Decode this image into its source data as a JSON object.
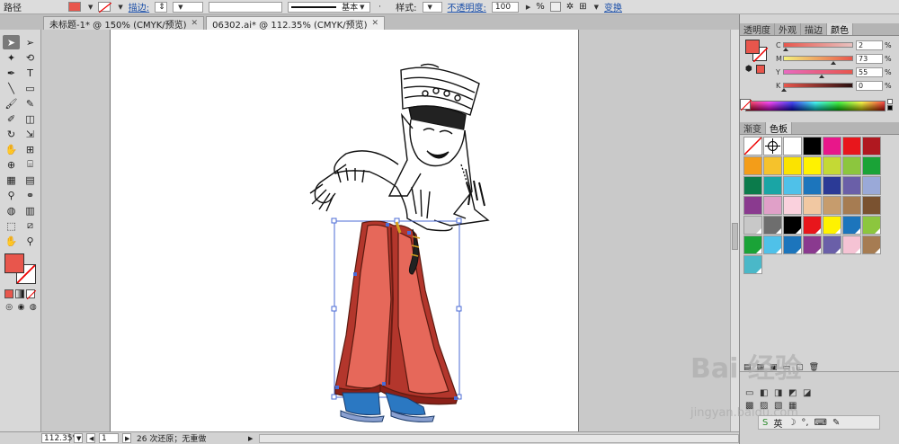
{
  "control_bar": {
    "path_label": "路径",
    "stroke_label": "描边:",
    "stroke_profile": "基本",
    "style_label": "样式:",
    "opacity_label": "不透明度:",
    "opacity_value": "100",
    "opacity_unit": "%",
    "transform_label": "变换",
    "fill_color": "#e8564c"
  },
  "tabs": [
    {
      "label": "未标题-1* @ 150% (CMYK/预览)"
    },
    {
      "label": "06302.ai* @ 112.35% (CMYK/预览)"
    }
  ],
  "toolbar": {
    "tools": [
      {
        "name": "selection-tool-icon",
        "glyph": "➤"
      },
      {
        "name": "direct-selection-tool-icon",
        "glyph": "➢"
      },
      {
        "name": "magic-wand-tool-icon",
        "glyph": "✦"
      },
      {
        "name": "lasso-tool-icon",
        "glyph": "⟲"
      },
      {
        "name": "pen-tool-icon",
        "glyph": "✒"
      },
      {
        "name": "type-tool-icon",
        "glyph": "T"
      },
      {
        "name": "line-tool-icon",
        "glyph": "╲"
      },
      {
        "name": "rectangle-tool-icon",
        "glyph": "▭"
      },
      {
        "name": "paintbrush-tool-icon",
        "glyph": "🖌"
      },
      {
        "name": "pencil-tool-icon",
        "glyph": "✎"
      },
      {
        "name": "blob-brush-tool-icon",
        "glyph": "✐"
      },
      {
        "name": "eraser-tool-icon",
        "glyph": "◫"
      },
      {
        "name": "rotate-tool-icon",
        "glyph": "↻"
      },
      {
        "name": "scale-tool-icon",
        "glyph": "⇲"
      },
      {
        "name": "warp-tool-icon",
        "glyph": "✋"
      },
      {
        "name": "free-transform-tool-icon",
        "glyph": "⊞"
      },
      {
        "name": "shape-builder-tool-icon",
        "glyph": "⊕"
      },
      {
        "name": "perspective-grid-tool-icon",
        "glyph": "⌸"
      },
      {
        "name": "mesh-tool-icon",
        "glyph": "▦"
      },
      {
        "name": "gradient-tool-icon",
        "glyph": "▤"
      },
      {
        "name": "eyedropper-tool-icon",
        "glyph": "⚲"
      },
      {
        "name": "blend-tool-icon",
        "glyph": "⚭"
      },
      {
        "name": "symbol-sprayer-tool-icon",
        "glyph": "◍"
      },
      {
        "name": "column-graph-tool-icon",
        "glyph": "▥"
      },
      {
        "name": "artboard-tool-icon",
        "glyph": "⬚"
      },
      {
        "name": "slice-tool-icon",
        "glyph": "⧄"
      },
      {
        "name": "hand-tool-icon",
        "glyph": "✋"
      },
      {
        "name": "zoom-tool-icon",
        "glyph": "⚲"
      }
    ]
  },
  "status_bar": {
    "zoom": "112.35%",
    "page": "1",
    "message": "26 次还原；无重做"
  },
  "color_panel": {
    "tabs": [
      "透明度",
      "外观",
      "描边",
      "颜色"
    ],
    "active_tab": "颜色",
    "channels": [
      {
        "letter": "C",
        "value": "2",
        "pct": 2,
        "gradient": "linear-gradient(90deg,#e8564c,#e8c2c0)"
      },
      {
        "letter": "M",
        "value": "73",
        "pct": 73,
        "gradient": "linear-gradient(90deg,#f4f07a,#e8564c)"
      },
      {
        "letter": "Y",
        "value": "55",
        "pct": 55,
        "gradient": "linear-gradient(90deg,#e86ac0,#e8564c)"
      },
      {
        "letter": "K",
        "value": "0",
        "pct": 0,
        "gradient": "linear-gradient(90deg,#e8564c,#2a1010)"
      }
    ],
    "unit": "%"
  },
  "swatch_panel": {
    "tabs": [
      "渐变",
      "色板"
    ],
    "active_tab": "色板",
    "swatches": [
      "none",
      "registration",
      "#ffffff",
      "#000000",
      "#e8178a",
      "#e8161c",
      "#b01820",
      "#f39d19",
      "#f5c22c",
      "#fbe300",
      "#fff200",
      "#c4d935",
      "#8cc63e",
      "#1aa337",
      "#0b7b4b",
      "#1aa5a5",
      "#4fc1e9",
      "#1c75bc",
      "#2b3a96",
      "#6a5fa8",
      "#9aa9d8",
      "#8a3a8f",
      "#e0a0c8",
      "#fad1dd",
      "#f1c8a2",
      "#c69c6d",
      "#a67c52",
      "#7a5230",
      "#c8c8c8",
      "#6e6e6e",
      "#000000",
      "#e8161c",
      "#fff200",
      "#1c75bc",
      "#8cc63e",
      "#1aa337",
      "#4fc1e9",
      "#1c75bc",
      "#8a3a8f",
      "#6a5fa8",
      "#f5c3d4",
      "#a67c52",
      "#4ab8c8"
    ]
  },
  "watermark": {
    "brand": "Bai 经验",
    "url": "jingyan.baidu.com"
  },
  "ime_bar": {
    "lang": "英"
  }
}
